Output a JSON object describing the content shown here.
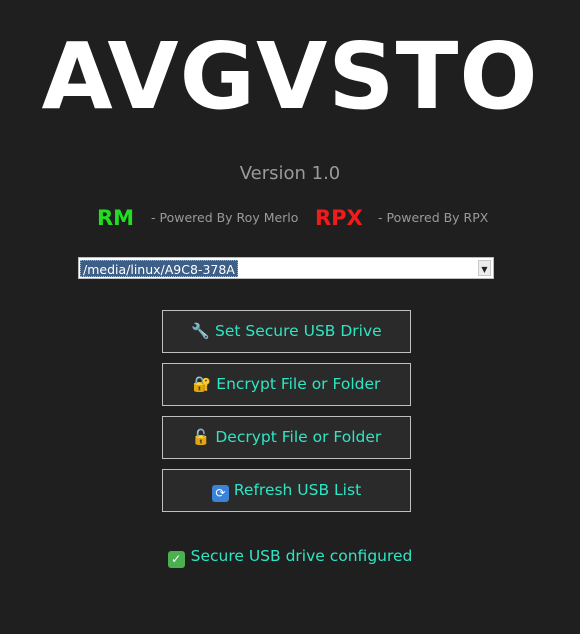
{
  "app": {
    "title": "AVGVSTO",
    "version": "Version 1.0"
  },
  "credits": [
    {
      "mark": "RM",
      "text": "- Powered By Roy Merlo",
      "color": "#22dd22"
    },
    {
      "mark": "RPX",
      "text": "- Powered By RPX",
      "color": "#ee1c1c"
    }
  ],
  "drive_select": {
    "value": "/media/linux/A9C8-378A"
  },
  "buttons": {
    "set_secure": {
      "label": "Set Secure USB Drive",
      "icon": "wrench-icon"
    },
    "encrypt": {
      "label": "Encrypt File or Folder",
      "icon": "lock-key-icon"
    },
    "decrypt": {
      "label": "Decrypt File or Folder",
      "icon": "unlock-icon"
    },
    "refresh": {
      "label": "Refresh USB List",
      "icon": "refresh-icon"
    }
  },
  "status": {
    "text": "Secure USB drive configured",
    "icon": "check-icon"
  },
  "colors": {
    "background": "#1f1f1f",
    "accent": "#2ee6c4",
    "title": "#ffffff",
    "muted": "#9a9a9a"
  }
}
